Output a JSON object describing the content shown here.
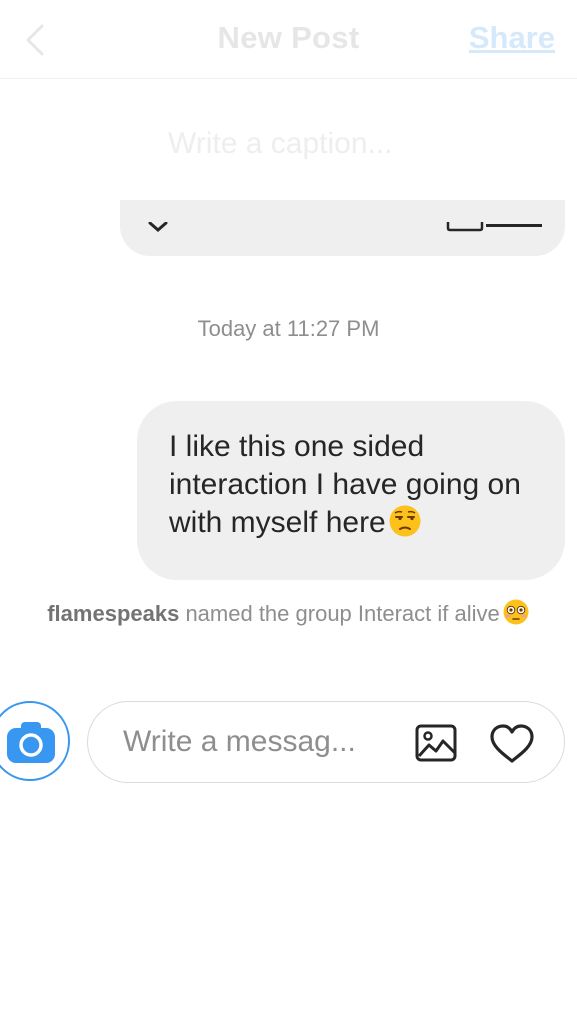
{
  "header": {
    "title": "New Post",
    "share_label": "Share",
    "back_icon": "chevron-left-icon"
  },
  "caption": {
    "placeholder": "Write a caption..."
  },
  "conversation": {
    "timestamp": "Today at 11:27 PM",
    "message": {
      "text": "I like this one sided interaction I have going on with myself here",
      "emoji": "unamused-face"
    },
    "system_notice": {
      "username": "flamespeaks",
      "text": " named the group Interact if alive",
      "emoji": "flushed-face"
    }
  },
  "composer": {
    "placeholder": "Write a messag...",
    "camera_icon": "camera-icon",
    "gallery_icon": "gallery-icon",
    "like_icon": "heart-icon"
  },
  "colors": {
    "accent": "#3897f0",
    "bubble": "#efefef",
    "muted_text": "#8e8e8e"
  }
}
